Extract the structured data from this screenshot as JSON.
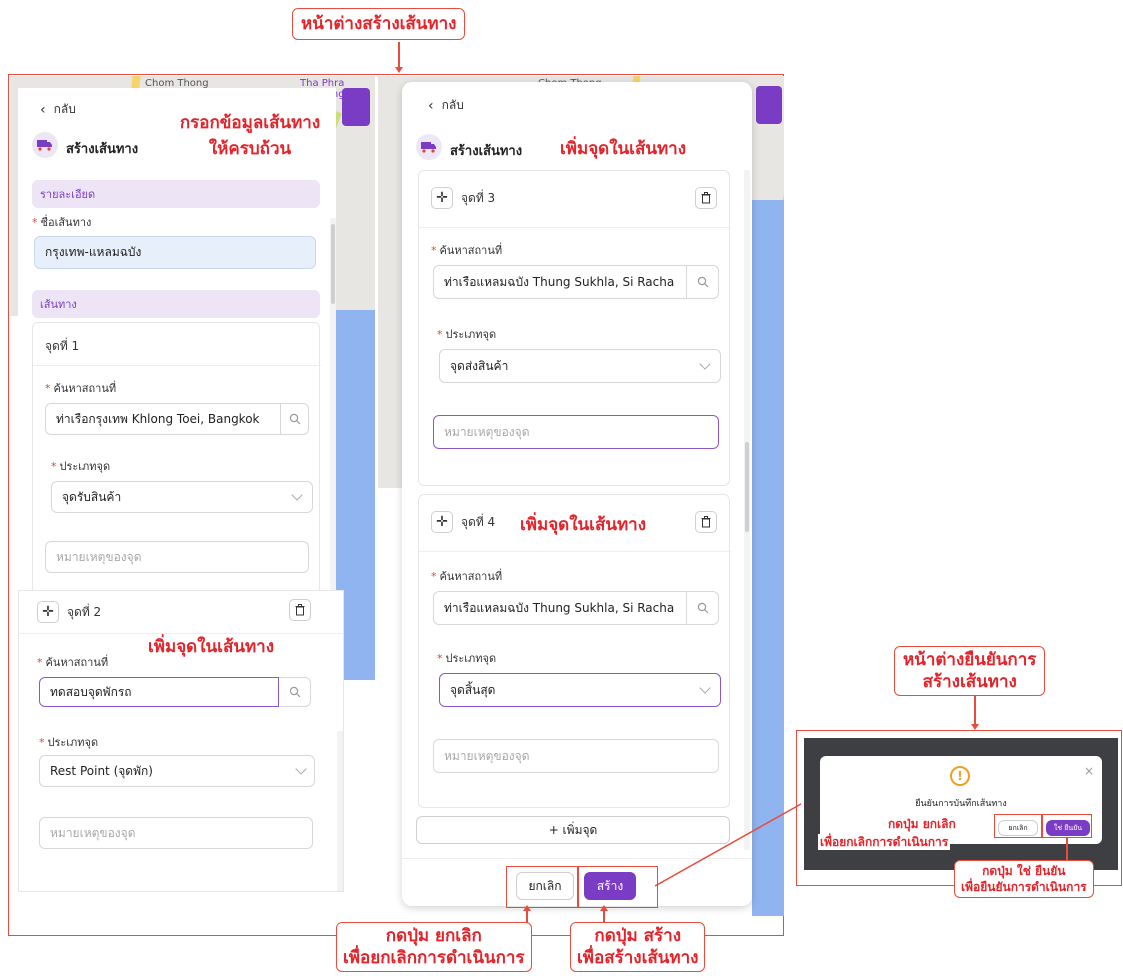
{
  "annotations": {
    "top_title": "หน้าต่างสร้างเส้นทาง",
    "note_fill": [
      "กรอกข้อมูลเส้นทาง",
      "ให้ครบถ้วน"
    ],
    "note_add_point": "เพิ่มจุดในเส้นทาง",
    "confirm_title": [
      "หน้าต่างยืนยันการ",
      "สร้างเส้นทาง"
    ],
    "cancel_note": [
      "กดปุ่ม ยกเลิก",
      "เพื่อยกเลิกการดำเนินการ"
    ],
    "create_note": [
      "กดปุ่ม สร้าง",
      "เพื่อสร้างเส้นทาง"
    ],
    "confirm_yes_note": [
      "กดปุ่ม ใช่ ยืนยัน",
      "เพื่อยืนยันการดำเนินการ"
    ]
  },
  "map": {
    "label_left": "Chom Thong",
    "label_right": "Chom Thong",
    "label_mid": "Tha Phra Chanong"
  },
  "left_panel": {
    "back": "กลับ",
    "title": "สร้างเส้นทาง",
    "section_details": "รายละเอียด",
    "route_name_label": "ชื่อเส้นทาง",
    "route_name_value": "กรุงเทพ-แหลมฉบัง",
    "section_route": "เส้นทาง",
    "point1": {
      "header": "จุดที่ 1",
      "search_label": "ค้นหาสถานที่",
      "search_value": "ท่าเรือกรุงเทพ Khlong Toei, Bangkok",
      "type_label": "ประเภทจุด",
      "type_value": "จุดรับสินค้า",
      "note_placeholder": "หมายเหตุของจุด"
    },
    "point2": {
      "header": "จุดที่ 2",
      "search_label": "ค้นหาสถานที่",
      "search_value": "ทดสอบจุดพักรถ",
      "type_label": "ประเภทจุด",
      "type_value": "Rest Point (จุดพัก)",
      "note_placeholder": "หมายเหตุของจุด"
    }
  },
  "right_panel": {
    "back": "กลับ",
    "title": "สร้างเส้นทาง",
    "point3": {
      "header": "จุดที่ 3",
      "search_label": "ค้นหาสถานที่",
      "search_value": "ท่าเรือแหลมฉบัง Thung Sukhla, Si Racha",
      "type_label": "ประเภทจุด",
      "type_value": "จุดส่งสินค้า",
      "note_placeholder": "หมายเหตุของจุด"
    },
    "point4": {
      "header": "จุดที่ 4",
      "search_label": "ค้นหาสถานที่",
      "search_value": "ท่าเรือแหลมฉบัง Thung Sukhla, Si Racha",
      "type_label": "ประเภทจุด",
      "type_value": "จุดสิ้นสุด",
      "note_placeholder": "หมายเหตุของจุด"
    },
    "add_point": "+ เพิ่มจุด",
    "cancel": "ยกเลิก",
    "create": "สร้าง"
  },
  "dialog": {
    "message": "ยืนยันการบันทึกเส้นทาง",
    "cancel": "ยกเลิก",
    "confirm": "ใช่ ยืนยัน",
    "close": "×",
    "icon": "warning-icon"
  },
  "colors": {
    "accent": "#7a3cc4",
    "annotation": "#e3242b",
    "route_name_fill": "#e6effa"
  }
}
